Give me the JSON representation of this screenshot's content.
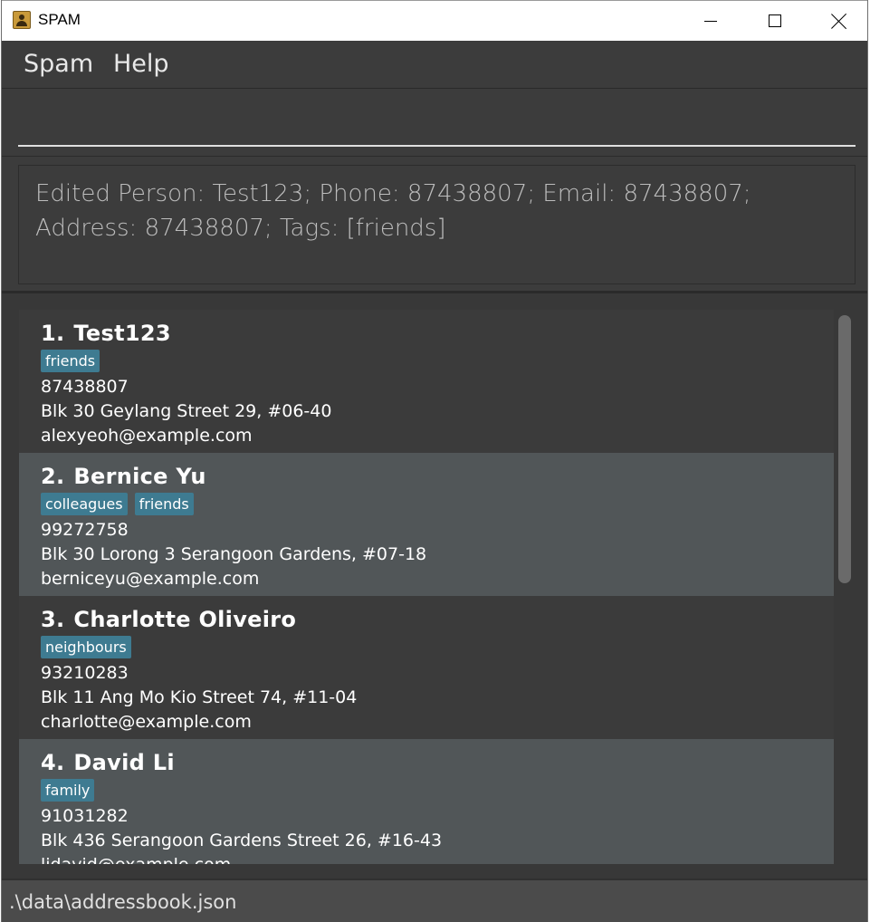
{
  "window": {
    "title": "SPAM"
  },
  "menu": {
    "items": [
      "Spam",
      "Help"
    ]
  },
  "command": {
    "value": "",
    "placeholder": ""
  },
  "result": {
    "text": "Edited Person: Test123; Phone: 87438807; Email: 87438807; Address: 87438807; Tags: [friends]"
  },
  "persons": [
    {
      "index": "1.",
      "name": "Test123",
      "tags": [
        "friends"
      ],
      "phone": "87438807",
      "address": "Blk 30 Geylang Street 29, #06-40",
      "email": "alexyeoh@example.com"
    },
    {
      "index": "2.",
      "name": "Bernice Yu",
      "tags": [
        "colleagues",
        "friends"
      ],
      "phone": "99272758",
      "address": "Blk 30 Lorong 3 Serangoon Gardens, #07-18",
      "email": "berniceyu@example.com"
    },
    {
      "index": "3.",
      "name": "Charlotte Oliveiro",
      "tags": [
        "neighbours"
      ],
      "phone": "93210283",
      "address": "Blk 11 Ang Mo Kio Street 74, #11-04",
      "email": "charlotte@example.com"
    },
    {
      "index": "4.",
      "name": "David Li",
      "tags": [
        "family"
      ],
      "phone": "91031282",
      "address": "Blk 436 Serangoon Gardens Street 26, #16-43",
      "email": "lidavid@example.com"
    }
  ],
  "status": {
    "file_path": ".\\data\\addressbook.json"
  },
  "colors": {
    "background": "#3c3c3c",
    "card_odd": "#3b3b3b",
    "card_even": "#515658",
    "tag": "#3e7b91"
  }
}
